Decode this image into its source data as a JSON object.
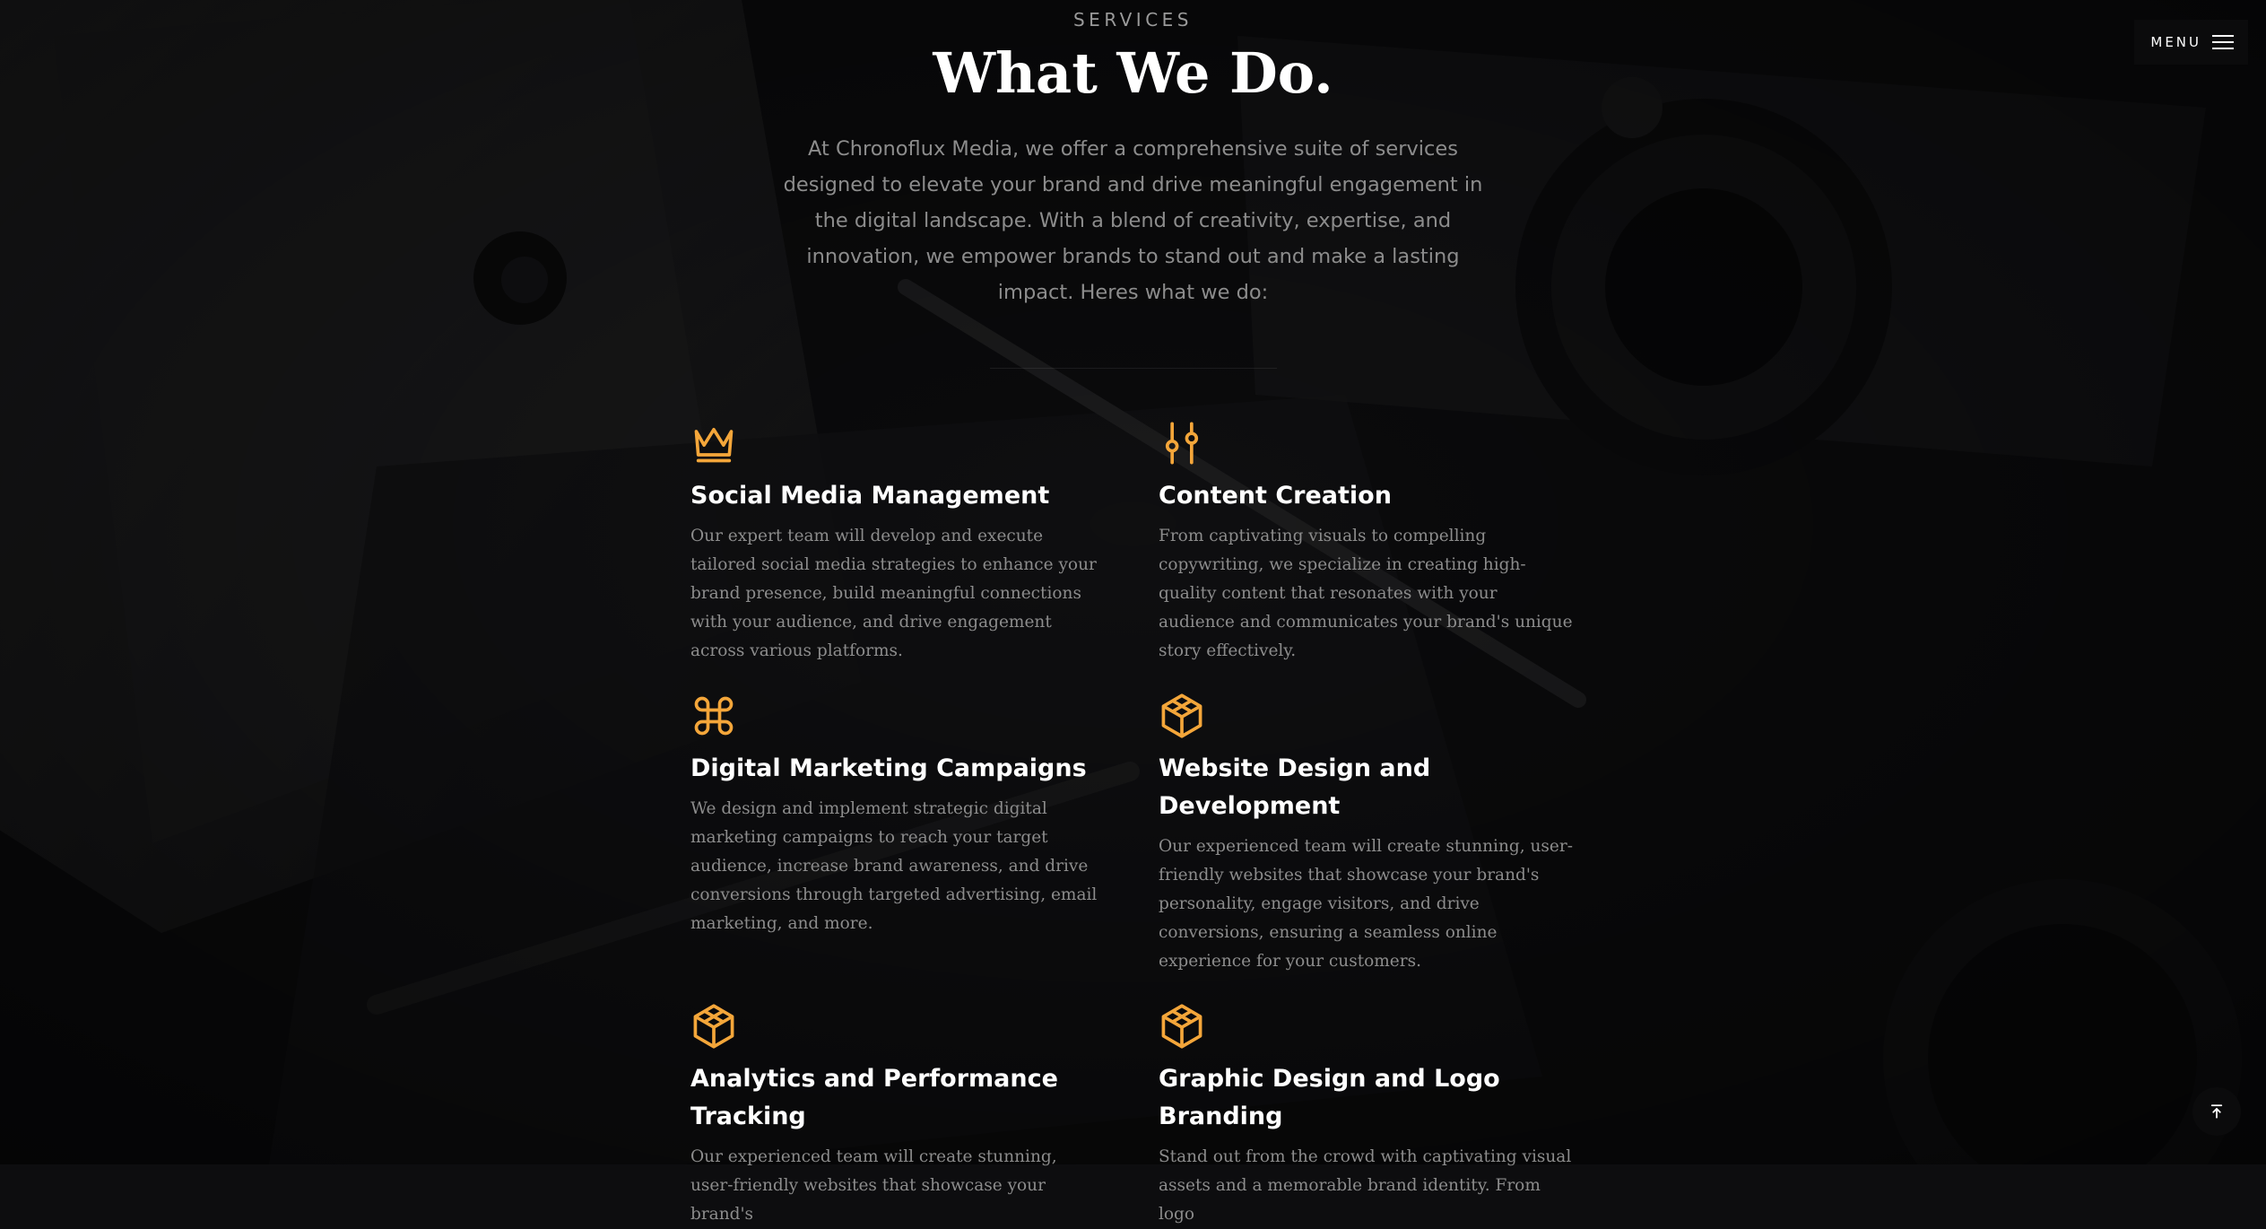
{
  "menu": {
    "label": "MENU"
  },
  "header": {
    "eyebrow": "SERVICES",
    "title": "What We Do.",
    "intro": "At Chronoflux Media, we offer a comprehensive suite of services designed to elevate your brand and drive meaningful engagement in the digital landscape. With a blend of creativity, expertise, and innovation, we empower brands to stand out and make a lasting impact. Heres what we do:"
  },
  "services": [
    {
      "icon": "crown-icon",
      "title": "Social Media Management",
      "description": "Our expert team will develop and execute tailored social media strategies to enhance your brand presence, build meaningful connections with your audience, and drive engagement across various platforms."
    },
    {
      "icon": "sliders-icon",
      "title": "Content Creation",
      "description": "From captivating visuals to compelling copywriting, we specialize in creating high-quality content that resonates with your audience and communicates your brand's unique story effectively."
    },
    {
      "icon": "command-icon",
      "title": "Digital Marketing Campaigns",
      "description": "We design and implement strategic digital marketing campaigns to reach your target audience, increase brand awareness, and drive conversions through targeted advertising, email marketing, and more."
    },
    {
      "icon": "cube-icon",
      "title": "Website Design and Development",
      "description": "Our experienced team will create stunning, user-friendly websites that showcase your brand's personality, engage visitors, and drive conversions, ensuring a seamless online experience for your customers."
    },
    {
      "icon": "cube-icon",
      "title": "Analytics and Performance Tracking",
      "description": "Our experienced team will create stunning, user-friendly websites that showcase your brand's"
    },
    {
      "icon": "cube-icon",
      "title": "Graphic Design and Logo Branding",
      "description": "Stand out from the crowd with captivating visual assets and a memorable brand identity. From logo"
    }
  ],
  "colors": {
    "accent": "#f4a63a",
    "background": "#0d0d0f",
    "text": "#ffffff",
    "muted": "#8c8c8c"
  },
  "scroll_top": {
    "icon": "arrow-up-to-line-icon"
  }
}
